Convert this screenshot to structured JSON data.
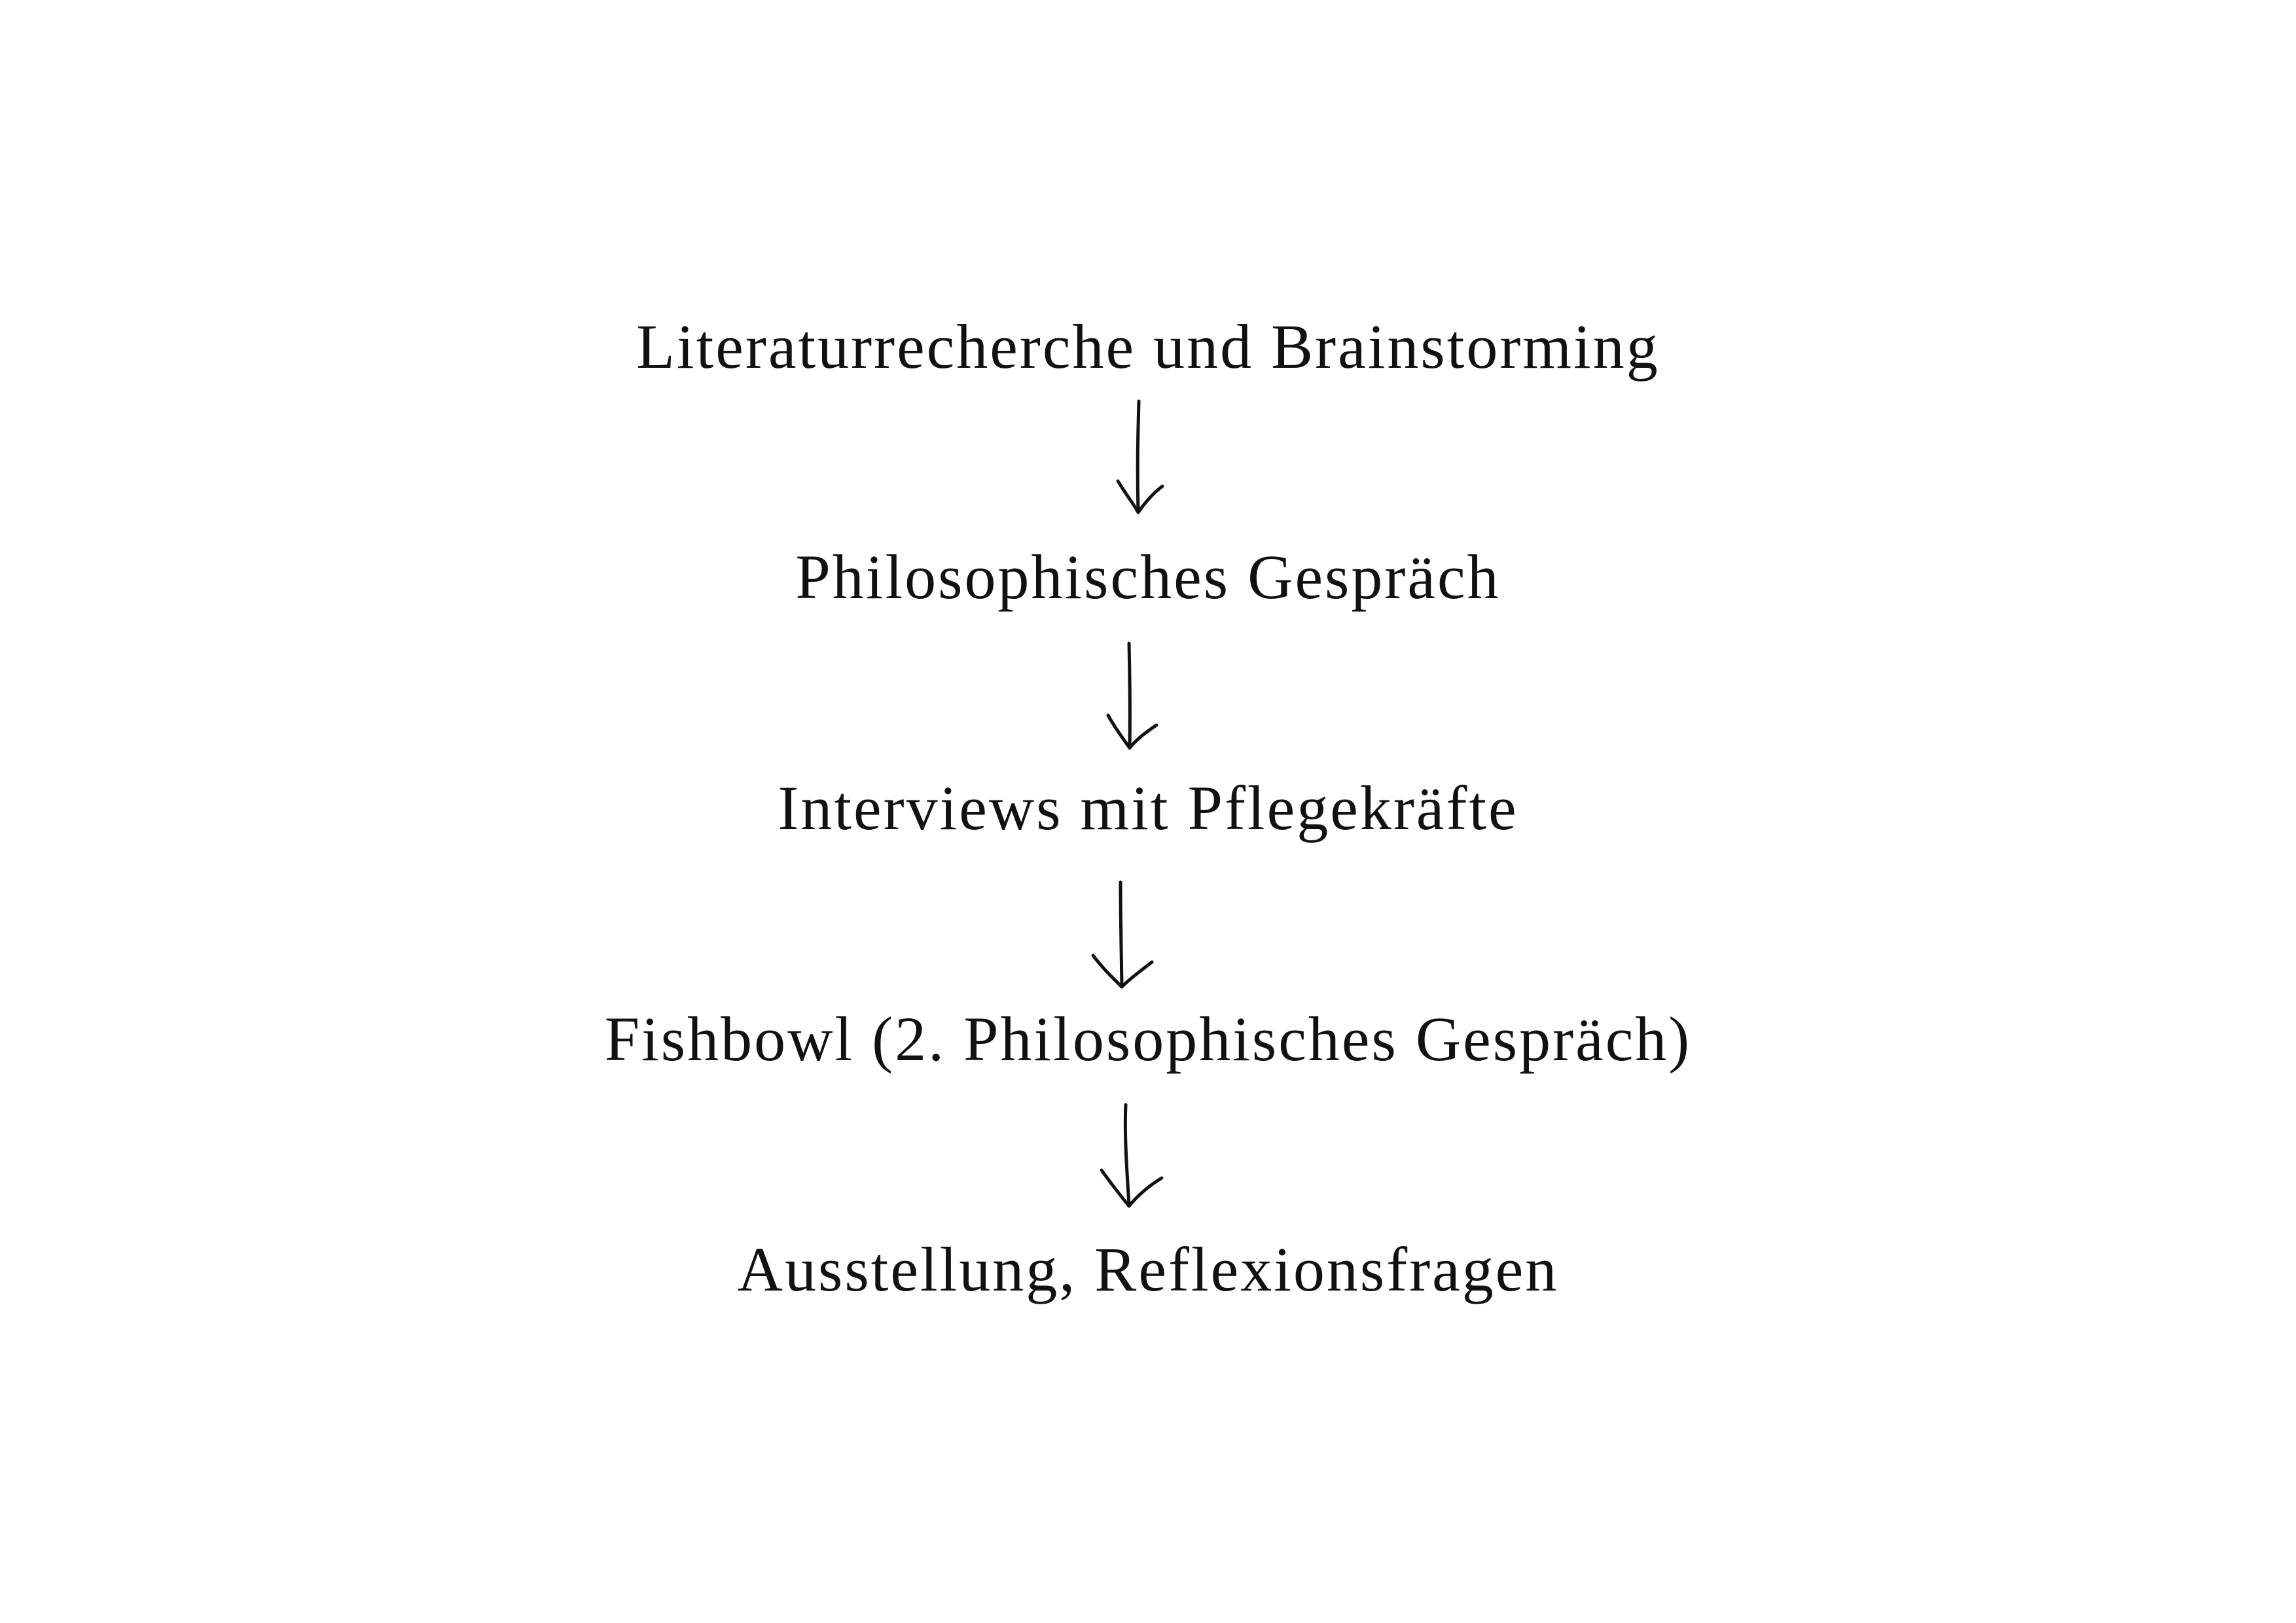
{
  "diagram": {
    "steps": [
      {
        "label": "Literaturrecherche und Brainstorming"
      },
      {
        "label": "Philosophisches Gespräch"
      },
      {
        "label": "Interviews mit Pflegekräfte"
      },
      {
        "label": "Fishbowl (2. Philosophisches Gespräch)"
      },
      {
        "label": "Ausstellung, Reflexionsfragen"
      }
    ],
    "connectors": [
      {
        "from": 0,
        "to": 1,
        "style": "hand-drawn-arrow"
      },
      {
        "from": 1,
        "to": 2,
        "style": "hand-drawn-arrow"
      },
      {
        "from": 2,
        "to": 3,
        "style": "hand-drawn-arrow"
      },
      {
        "from": 3,
        "to": 4,
        "style": "hand-drawn-arrow"
      }
    ],
    "colors": {
      "background": "#ffffff",
      "ink": "#111111"
    }
  }
}
